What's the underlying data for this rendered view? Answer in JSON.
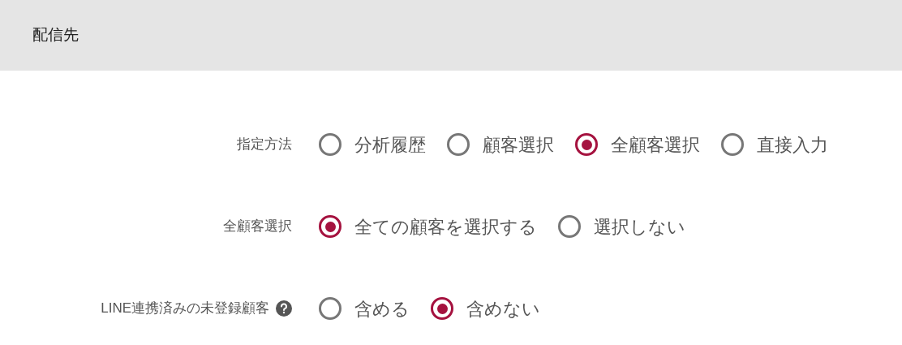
{
  "header": {
    "title": "配信先"
  },
  "fields": [
    {
      "label": "指定方法",
      "help": false,
      "options": [
        {
          "label": "分析履歴",
          "selected": false
        },
        {
          "label": "顧客選択",
          "selected": false
        },
        {
          "label": "全顧客選択",
          "selected": true
        },
        {
          "label": "直接入力",
          "selected": false
        }
      ]
    },
    {
      "label": "全顧客選択",
      "help": false,
      "options": [
        {
          "label": "全ての顧客を選択する",
          "selected": true
        },
        {
          "label": "選択しない",
          "selected": false
        }
      ]
    },
    {
      "label": "LINE連携済みの未登録顧客",
      "help": true,
      "options": [
        {
          "label": "含める",
          "selected": false
        },
        {
          "label": "含めない",
          "selected": true
        }
      ]
    }
  ]
}
